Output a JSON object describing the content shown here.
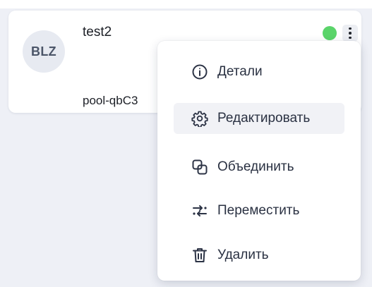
{
  "card": {
    "avatar_text": "BLZ",
    "title": "test2",
    "subtitle": "pool-qbC3",
    "status_color": "#5ad46a"
  },
  "menu": {
    "items": [
      {
        "label": "Детали",
        "icon": "info-icon"
      },
      {
        "label": "Редактировать",
        "icon": "gear-icon"
      },
      {
        "label": "Объединить",
        "icon": "merge-icon"
      },
      {
        "label": "Переместить",
        "icon": "move-icon"
      },
      {
        "label": "Удалить",
        "icon": "trash-icon"
      }
    ]
  }
}
